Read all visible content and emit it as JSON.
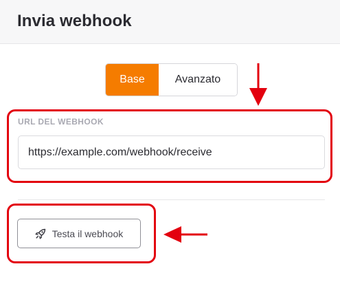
{
  "header": {
    "title": "Invia webhook"
  },
  "tabs": [
    {
      "label": "Base",
      "active": true
    },
    {
      "label": "Avanzato",
      "active": false
    }
  ],
  "webhook_url": {
    "label": "URL DEL WEBHOOK",
    "value": "https://example.com/webhook/receive"
  },
  "test_button": {
    "label": "Testa il webhook",
    "icon": "rocket-icon"
  },
  "colors": {
    "accent": "#f57c00",
    "annotation": "#e3000f"
  }
}
